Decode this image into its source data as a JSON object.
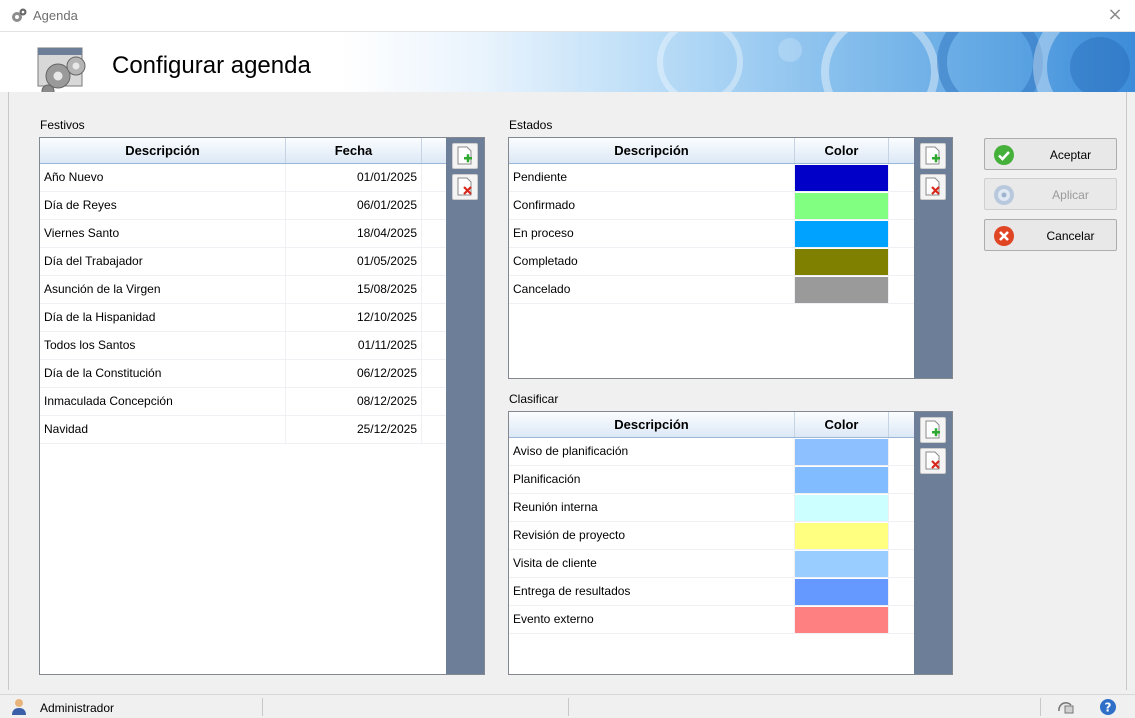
{
  "window": {
    "title": "Agenda",
    "close_glyph": "×"
  },
  "header": {
    "title": "Configurar agenda"
  },
  "festivos": {
    "label": "Festivos",
    "columns": [
      "Descripción",
      "Fecha"
    ],
    "rows": [
      {
        "desc": "Año Nuevo",
        "date": "01/01/2025"
      },
      {
        "desc": "Día de Reyes",
        "date": "06/01/2025"
      },
      {
        "desc": "Viernes Santo",
        "date": "18/04/2025"
      },
      {
        "desc": "Día del Trabajador",
        "date": "01/05/2025"
      },
      {
        "desc": "Asunción de la Virgen",
        "date": "15/08/2025"
      },
      {
        "desc": "Día de la Hispanidad",
        "date": "12/10/2025"
      },
      {
        "desc": "Todos los Santos",
        "date": "01/11/2025"
      },
      {
        "desc": "Día de la Constitución",
        "date": "06/12/2025"
      },
      {
        "desc": "Inmaculada Concepción",
        "date": "08/12/2025"
      },
      {
        "desc": "Navidad",
        "date": "25/12/2025"
      }
    ]
  },
  "estados": {
    "label": "Estados",
    "columns": [
      "Descripción",
      "Color"
    ],
    "rows": [
      {
        "desc": "Pendiente",
        "color": "#0000c8"
      },
      {
        "desc": "Confirmado",
        "color": "#80ff80"
      },
      {
        "desc": "En proceso",
        "color": "#00a2ff"
      },
      {
        "desc": "Completado",
        "color": "#808000"
      },
      {
        "desc": "Cancelado",
        "color": "#9a9a9a"
      }
    ]
  },
  "clasificar": {
    "label": "Clasificar",
    "columns": [
      "Descripción",
      "Color"
    ],
    "rows": [
      {
        "desc": "Aviso de planificación",
        "color": "#8cc0ff"
      },
      {
        "desc": "Planificación",
        "color": "#80bcff"
      },
      {
        "desc": "Reunión interna",
        "color": "#ccffff"
      },
      {
        "desc": "Revisión de proyecto",
        "color": "#ffff80"
      },
      {
        "desc": "Visita de cliente",
        "color": "#99ccff"
      },
      {
        "desc": "Entrega de resultados",
        "color": "#6699ff"
      },
      {
        "desc": "Evento externo",
        "color": "#ff8080"
      }
    ]
  },
  "actions": {
    "accept": "Aceptar",
    "apply": "Aplicar",
    "cancel": "Cancelar"
  },
  "statusbar": {
    "user": "Administrador"
  },
  "icons": {
    "app": "gears-icon",
    "add": "add-document-icon",
    "delete": "delete-document-icon",
    "accept": "check-icon",
    "apply": "disc-icon",
    "cancel": "cancel-icon",
    "user": "user-icon",
    "shape": "shapes-icon",
    "help": "help-icon"
  },
  "colors": {
    "strip": "#6d7f98",
    "accent": "#3d8cd9"
  }
}
